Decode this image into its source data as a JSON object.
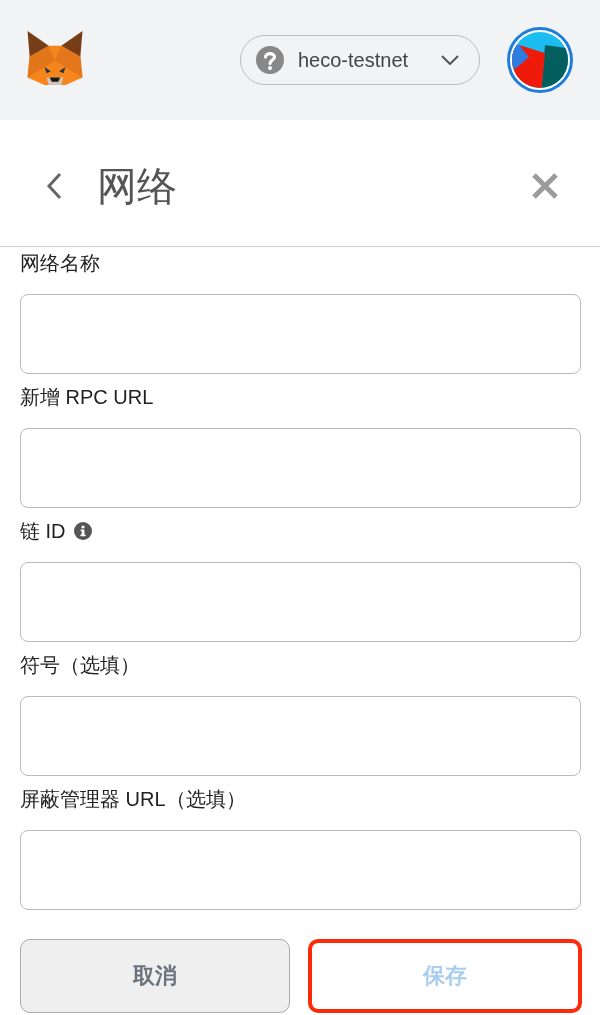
{
  "header": {
    "network": {
      "label": "heco-testnet"
    }
  },
  "page": {
    "title": "网络"
  },
  "fields": [
    {
      "label": "网络名称",
      "info_icon": false
    },
    {
      "label": "新增 RPC URL",
      "info_icon": false
    },
    {
      "label": "链 ID",
      "info_icon": true
    },
    {
      "label": "符号（选填）",
      "info_icon": false
    },
    {
      "label": "屏蔽管理器 URL（选填）",
      "info_icon": false
    }
  ],
  "buttons": [
    {
      "label": "取消",
      "kind": "cancel",
      "disabled": false,
      "highlighted": false
    },
    {
      "label": "保存",
      "kind": "save",
      "disabled": true,
      "highlighted": true
    }
  ]
}
